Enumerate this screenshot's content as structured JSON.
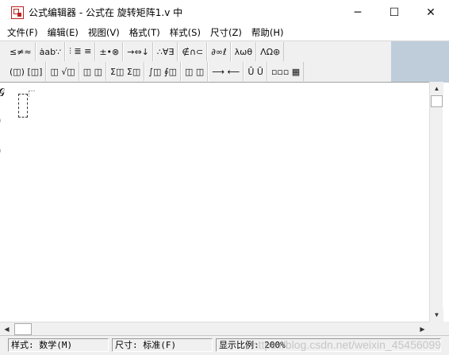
{
  "window": {
    "title": "公式编辑器 - 公式在 旋转矩阵1.v 中",
    "minimize_glyph": "─",
    "maximize_glyph": "☐",
    "close_glyph": "✕"
  },
  "menu": [
    "文件(F)",
    "编辑(E)",
    "视图(V)",
    "格式(T)",
    "样式(S)",
    "尺寸(Z)",
    "帮助(H)"
  ],
  "toolbar": {
    "row1": [
      "≤≠≈",
      "ȧab∵",
      "⫶ ≣ ≡",
      "±•⊗",
      "→⇔↓",
      "∴∀∃",
      "∉∩⊂",
      "∂∞ℓ",
      "λωθ",
      "ΛΩ⊛"
    ],
    "row2": [
      "(◫) [◫]",
      "◫ √◫",
      "◫ ◫",
      "Σ◫ Σ◫",
      "∫◫ ∮◫",
      "◫ ◫",
      "⟶ ⟵",
      "Ū Ŭ",
      "▫▫▫ ▦"
    ]
  },
  "scrollbar": {
    "up": "▲",
    "down": "▼",
    "left": "◀",
    "right": "▶"
  },
  "status": {
    "style": "样式: 数学(M)",
    "size": "尺寸: 标准(F)",
    "zoom": "显示比例: 200%"
  },
  "watermark": "https://blog.csdn.net/weixin_45456099",
  "colors": {
    "toolbar_bg": "#f0f0f0",
    "blank_panel": "#bfcddb",
    "icon_red": "#b22222"
  }
}
